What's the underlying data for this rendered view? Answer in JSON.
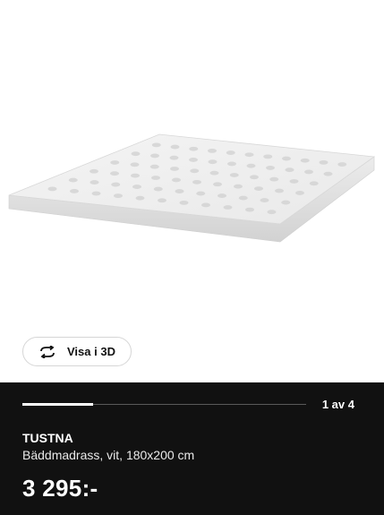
{
  "product_image": {
    "icon": "mattress-topper-image"
  },
  "view3d": {
    "label": "Visa i 3D",
    "icon": "rotate-3d-icon"
  },
  "gallery": {
    "counter": "1 av 4",
    "current": 1,
    "total": 4,
    "progress_fraction": 0.25
  },
  "product": {
    "name": "TUSTNA",
    "description": "Bäddmadrass, vit, 180x200 cm",
    "price": "3 295:-"
  }
}
